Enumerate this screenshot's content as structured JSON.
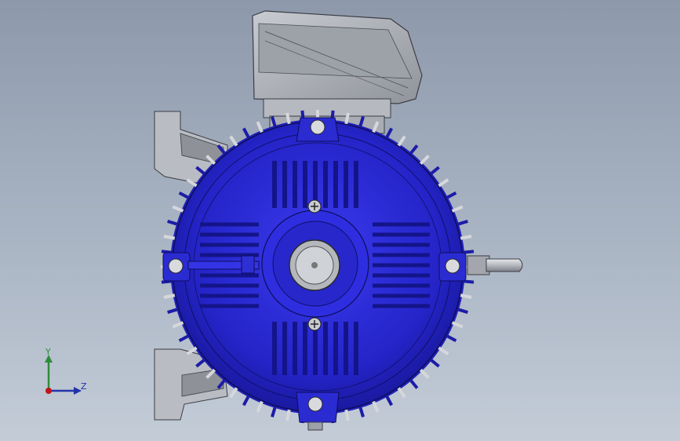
{
  "viewport": {
    "background_top": "#8d99ab",
    "background_bottom": "#c3ccd7"
  },
  "model": {
    "body_color": "#2a2ad0",
    "body_dark": "#12128a",
    "casting_color": "#b9bcc2",
    "casting_shadow": "#8e9198",
    "shaft_color": "#c9ccd0"
  },
  "triad": {
    "y_label": "Y",
    "z_label": "Z",
    "y_color": "#2e8b3a",
    "z_color": "#2233aa",
    "origin_color": "#c0141a"
  }
}
